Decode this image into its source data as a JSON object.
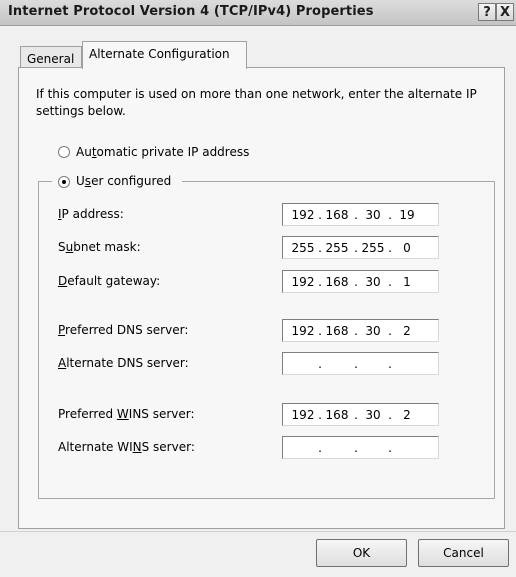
{
  "window": {
    "title": "Internet Protocol Version 4 (TCP/IPv4) Properties",
    "help_label": "?",
    "close_label": "X"
  },
  "tabs": [
    {
      "label": "General",
      "selected": false
    },
    {
      "label": "Alternate Configuration",
      "selected": true
    }
  ],
  "description": "If this computer is used on more than one network, enter the alternate IP settings below.",
  "options": {
    "automatic": {
      "label": "Automatic private IP address",
      "checked": false
    },
    "user": {
      "label": "User configured",
      "checked": true
    }
  },
  "fields": {
    "ip_address": {
      "label": "IP address:",
      "octets": [
        "192",
        "168",
        "30",
        "19"
      ]
    },
    "subnet_mask": {
      "label": "Subnet mask:",
      "octets": [
        "255",
        "255",
        "255",
        "0"
      ]
    },
    "default_gateway": {
      "label": "Default gateway:",
      "octets": [
        "192",
        "168",
        "30",
        "1"
      ]
    },
    "preferred_dns": {
      "label": "Preferred DNS server:",
      "octets": [
        "192",
        "168",
        "30",
        "2"
      ]
    },
    "alternate_dns": {
      "label": "Alternate DNS server:",
      "octets": [
        "",
        "",
        "",
        ""
      ]
    },
    "preferred_wins": {
      "label": "Preferred WINS server:",
      "octets": [
        "192",
        "168",
        "30",
        "2"
      ]
    },
    "alternate_wins": {
      "label": "Alternate WINS server:",
      "octets": [
        "",
        "",
        "",
        ""
      ]
    }
  },
  "buttons": {
    "ok": "OK",
    "cancel": "Cancel"
  }
}
